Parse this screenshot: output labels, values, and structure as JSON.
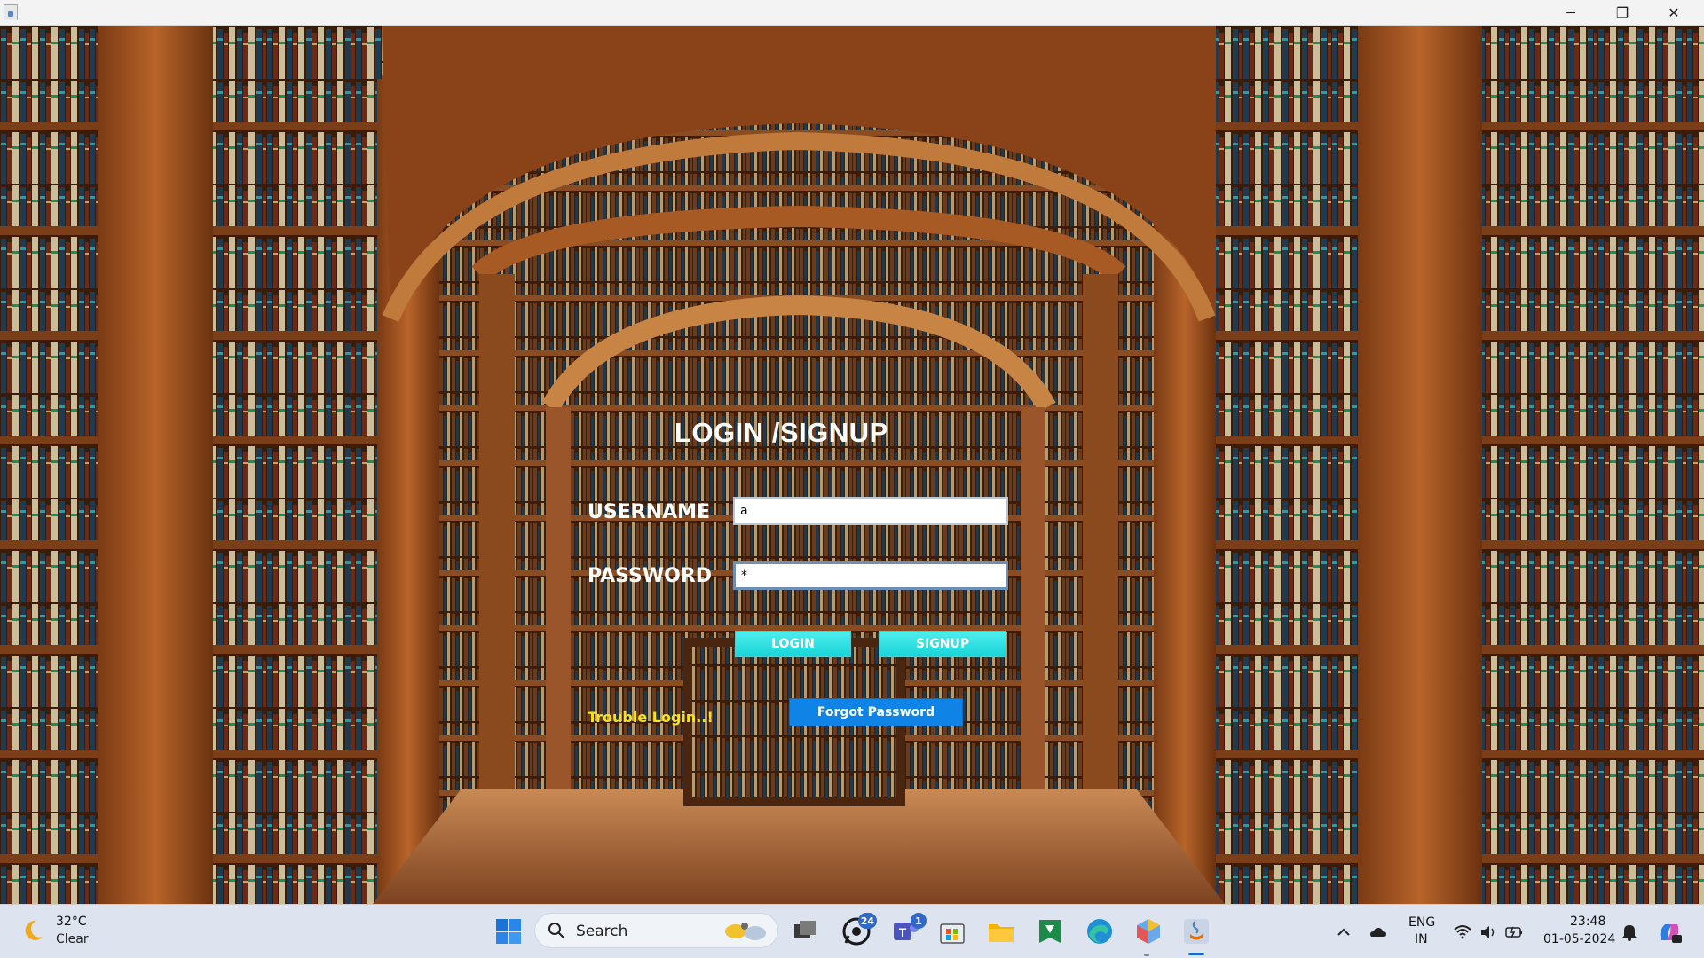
{
  "window": {
    "minimize_symbol": "─",
    "maximize_symbol": "❐",
    "close_symbol": "✕"
  },
  "form": {
    "title": "LOGIN /SIGNUP",
    "username_label": "USERNAME",
    "password_label": "PASSWORD",
    "username_value": "a",
    "password_value": "*",
    "login_button": "LOGIN",
    "signup_button": "SIGNUP",
    "forgot_password_button": "Forgot Password",
    "trouble_link": "Trouble Login..!",
    "colors": {
      "title": "#ffffff",
      "button_cyan": "#19d4d6",
      "forgot_button_blue": "#0f84e6",
      "trouble_link": "#f5e21a"
    }
  },
  "taskbar": {
    "weather": {
      "temp": "32°C",
      "condition": "Clear",
      "icon": "moon-icon"
    },
    "search_placeholder": "Search",
    "apps": [
      {
        "name": "task-view",
        "icon": "task-view-icon"
      },
      {
        "name": "whatsapp",
        "icon": "whatsapp-icon",
        "badge": "24"
      },
      {
        "name": "teams",
        "icon": "teams-icon",
        "badge": "1"
      },
      {
        "name": "microsoft-store",
        "icon": "store-icon"
      },
      {
        "name": "file-explorer",
        "icon": "folder-icon"
      },
      {
        "name": "green-app",
        "icon": "shield-icon"
      },
      {
        "name": "edge",
        "icon": "edge-icon"
      },
      {
        "name": "app-gem",
        "icon": "gem-icon"
      },
      {
        "name": "java",
        "icon": "java-icon"
      }
    ],
    "language_line1": "ENG",
    "language_line2": "IN",
    "time": "23:48",
    "date": "01-05-2024"
  }
}
